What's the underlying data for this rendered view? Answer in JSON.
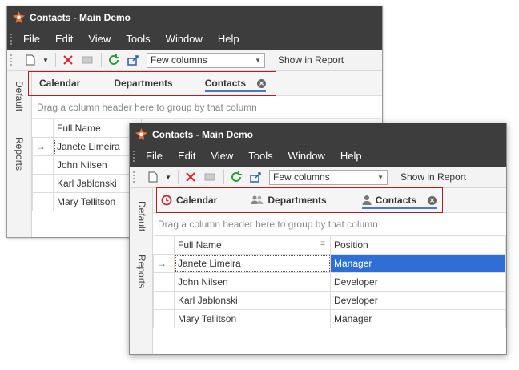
{
  "window_back": {
    "title": "Contacts - Main Demo",
    "menu": [
      "File",
      "Edit",
      "View",
      "Tools",
      "Window",
      "Help"
    ],
    "toolbar": {
      "view_combo_value": "Few columns",
      "show_in_report": "Show in Report"
    },
    "sidebar": {
      "default": "Default",
      "reports": "Reports"
    },
    "tabs": [
      {
        "label": "Calendar"
      },
      {
        "label": "Departments"
      },
      {
        "label": "Contacts"
      }
    ],
    "group_panel": "Drag a column header here to group by that column",
    "grid": {
      "columns": [
        "Full Name"
      ],
      "rows": [
        {
          "full_name": "Janete Limeira"
        },
        {
          "full_name": "John Nilsen"
        },
        {
          "full_name": "Karl Jablonski"
        },
        {
          "full_name": "Mary Tellitson"
        }
      ]
    }
  },
  "window_front": {
    "title": "Contacts - Main Demo",
    "menu": [
      "File",
      "Edit",
      "View",
      "Tools",
      "Window",
      "Help"
    ],
    "toolbar": {
      "view_combo_value": "Few columns",
      "show_in_report": "Show in Report"
    },
    "sidebar": {
      "default": "Default",
      "reports": "Reports"
    },
    "tabs": [
      {
        "label": "Calendar"
      },
      {
        "label": "Departments"
      },
      {
        "label": "Contacts"
      }
    ],
    "group_panel": "Drag a column header here to group by that column",
    "grid": {
      "columns": [
        "Full Name",
        "Position"
      ],
      "rows": [
        {
          "full_name": "Janete Limeira",
          "position": "Manager"
        },
        {
          "full_name": "John Nilsen",
          "position": "Developer"
        },
        {
          "full_name": "Karl Jablonski",
          "position": "Developer"
        },
        {
          "full_name": "Mary Tellitson",
          "position": "Manager"
        }
      ]
    }
  },
  "colors": {
    "accent": "#2e6fd6",
    "highlight": "#b01e23",
    "titlebar": "#3d3d3d"
  },
  "icons": {
    "app": "gear-logo-icon",
    "new": "new-document-icon",
    "delete": "red-x-icon",
    "refresh": "refresh-icon",
    "export": "export-icon",
    "calendar": "clock-icon",
    "departments": "users-icon",
    "contacts": "user-icon",
    "close": "close-circle-icon"
  }
}
